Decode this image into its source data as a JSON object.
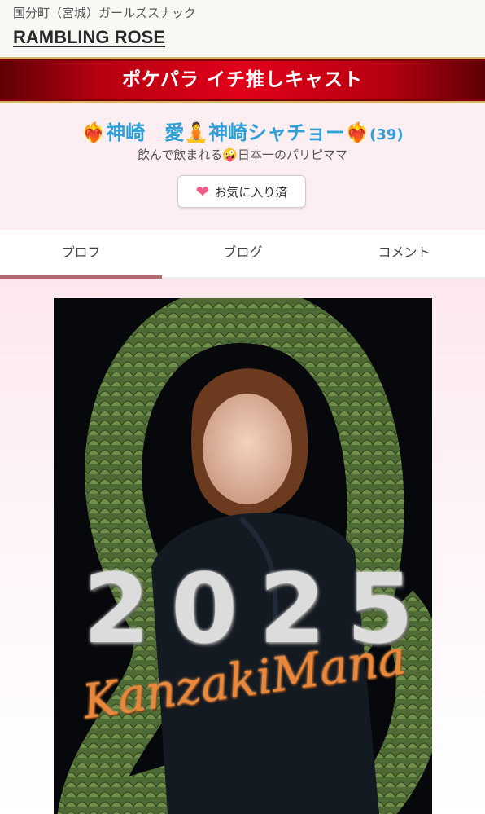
{
  "header": {
    "breadcrumb": "国分町（宮城）ガールズスナック",
    "store_name": "RAMBLING ROSE"
  },
  "banner": {
    "title": "ポケパラ イチ推しキャスト"
  },
  "profile": {
    "name": "❤️‍🔥神崎　愛🧘神崎シャチョー❤️‍🔥",
    "age": "(39)",
    "catchphrase": "飲んで飲まれる🤪日本一のパリピママ",
    "favorite_label": "お気に入り済"
  },
  "tabs": [
    {
      "label": "プロフ",
      "active": true
    },
    {
      "label": "ブログ",
      "active": false
    },
    {
      "label": "コメント",
      "active": false
    }
  ],
  "poster": {
    "year_digits": [
      "2",
      "0",
      "2",
      "5"
    ],
    "signature": "KanzakiMana"
  },
  "colors": {
    "banner_red": "#e2001a",
    "name_blue": "#2f9fd8",
    "active_tab_bar": "#b06a6f",
    "heart_pink": "#ef5a86"
  }
}
